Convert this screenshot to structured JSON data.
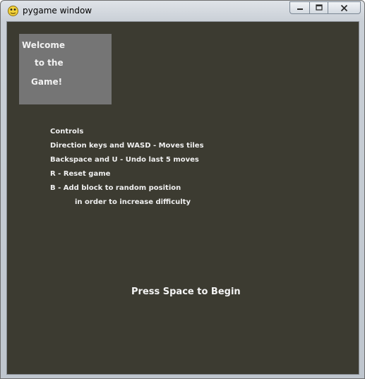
{
  "window": {
    "title": "pygame window",
    "icon": "pygame-snake-icon",
    "buttons": {
      "minimize_icon": "minimize-icon",
      "maximize_icon": "maximize-icon",
      "close_icon": "close-icon"
    }
  },
  "game": {
    "background_color": "#3c3b31",
    "welcome": {
      "lines": [
        "Welcome",
        "to the",
        "Game!"
      ],
      "box_color": "#757575"
    },
    "controls": {
      "heading": "Controls",
      "items": [
        "Direction keys and WASD - Moves tiles",
        "Backspace and U - Undo last 5 moves",
        "R - Reset game",
        "B - Add block to random position",
        "in order to increase difficulty"
      ]
    },
    "prompt": "Press Space to Begin"
  }
}
